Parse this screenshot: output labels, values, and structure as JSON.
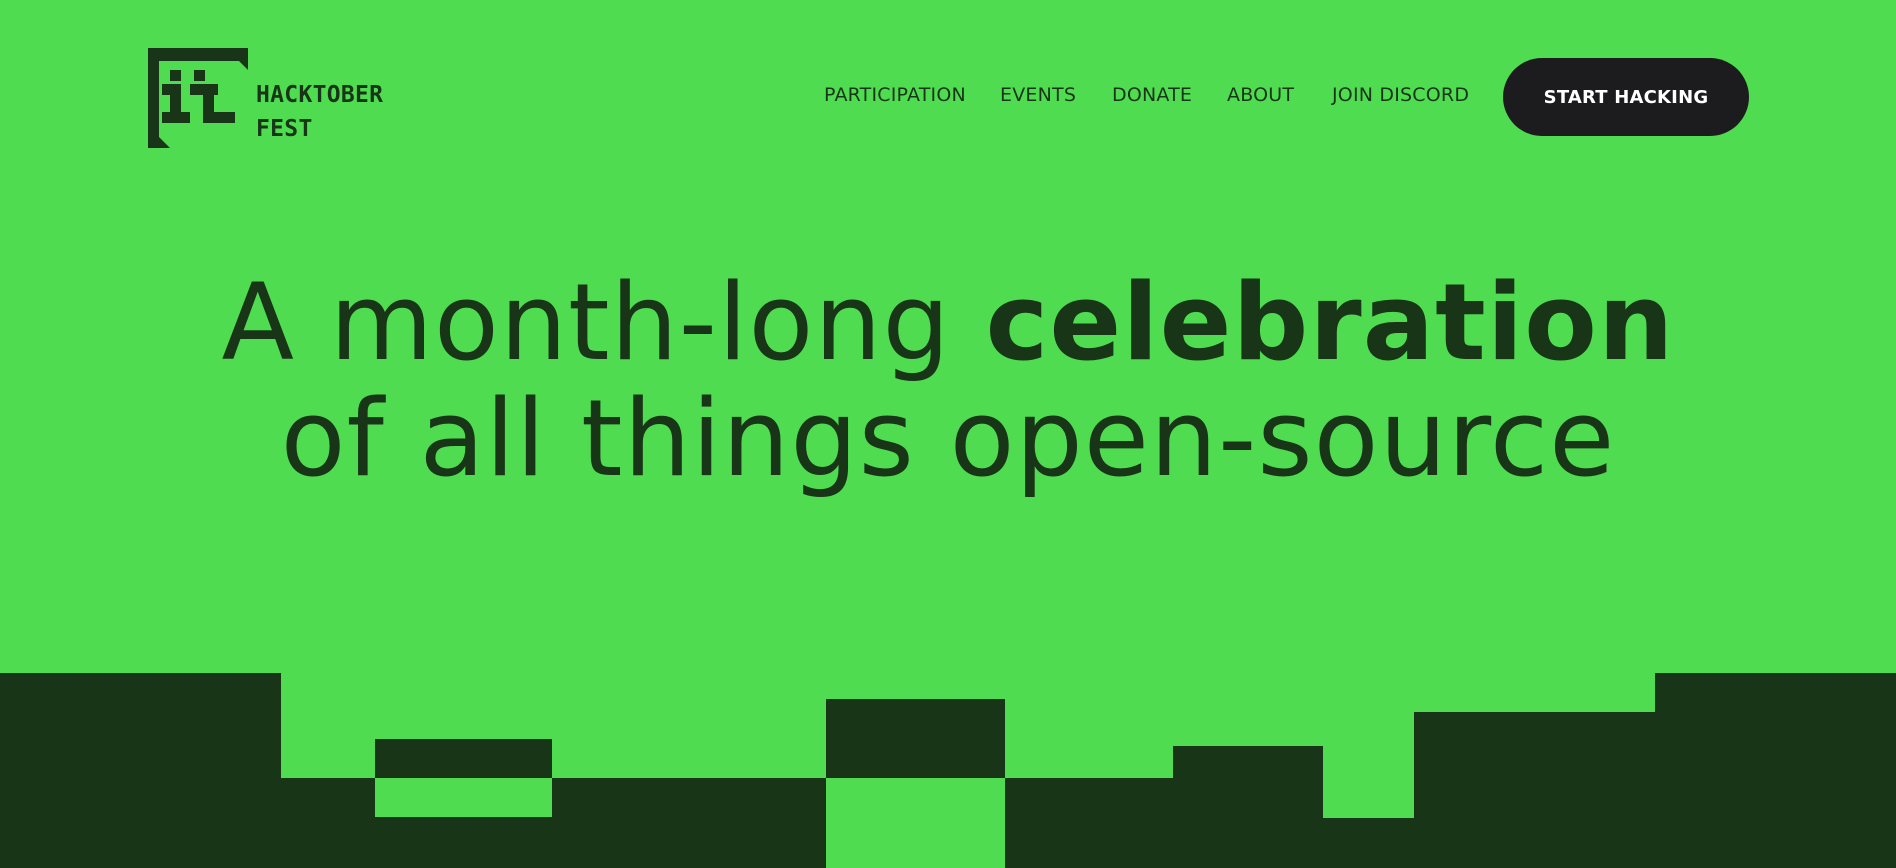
{
  "brand": {
    "line1": "HACKTOBER",
    "line2": "FEST"
  },
  "nav": {
    "items": [
      {
        "label": "PARTICIPATION"
      },
      {
        "label": "EVENTS"
      },
      {
        "label": "DONATE"
      },
      {
        "label": "ABOUT"
      },
      {
        "label": "JOIN DISCORD"
      }
    ],
    "cta_label": "START HACKING"
  },
  "hero": {
    "regular": "A month-long ",
    "bold": "celebration",
    "line2": "of all things open-source"
  },
  "colors": {
    "background": "#50DC50",
    "ink": "#183518",
    "button": "#1C1C1E",
    "button_text": "#FFFFFF"
  }
}
